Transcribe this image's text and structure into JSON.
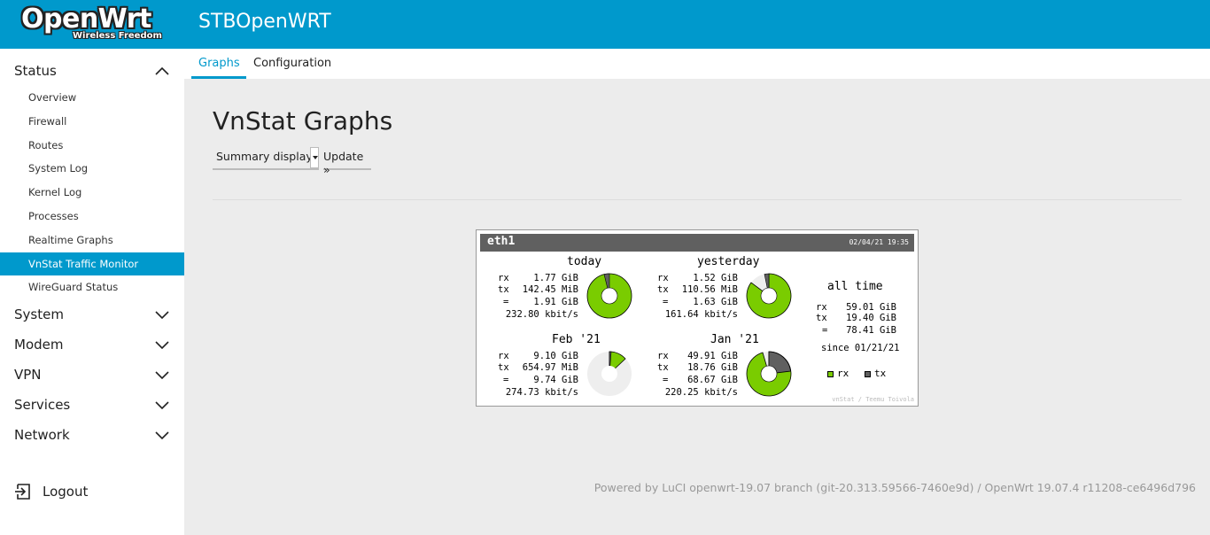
{
  "header": {
    "logo_main": "OpenWrt",
    "logo_sub": "Wireless Freedom",
    "hostname": "STBOpenWRT"
  },
  "sidebar": {
    "status_label": "Status",
    "status_items": [
      {
        "label": "Overview"
      },
      {
        "label": "Firewall"
      },
      {
        "label": "Routes"
      },
      {
        "label": "System Log"
      },
      {
        "label": "Kernel Log"
      },
      {
        "label": "Processes"
      },
      {
        "label": "Realtime Graphs"
      },
      {
        "label": "VnStat Traffic Monitor",
        "active": true
      },
      {
        "label": "WireGuard Status"
      }
    ],
    "groups": [
      "System",
      "Modem",
      "VPN",
      "Services",
      "Network"
    ],
    "logout_label": "Logout"
  },
  "tabs": [
    {
      "label": "Graphs",
      "active": true
    },
    {
      "label": "Configuration",
      "active": false
    }
  ],
  "main": {
    "title": "VnStat Graphs",
    "select_value": "Summary display",
    "update_label": "Update »"
  },
  "vnstat": {
    "interface": "eth1",
    "timestamp": "02/04/21 19:35",
    "today": {
      "title": "today",
      "rx": "1.77 GiB",
      "tx": "142.45 MiB",
      "total": "1.91 GiB",
      "rate": "232.80 kbit/s"
    },
    "yesterday": {
      "title": "yesterday",
      "rx": "1.52 GiB",
      "tx": "110.56 MiB",
      "total": "1.63 GiB",
      "rate": "161.64 kbit/s"
    },
    "feb": {
      "title": "Feb '21",
      "rx": "9.10 GiB",
      "tx": "654.97 MiB",
      "total": "9.74 GiB",
      "rate": "274.73 kbit/s"
    },
    "jan": {
      "title": "Jan '21",
      "rx": "49.91 GiB",
      "tx": "18.76 GiB",
      "total": "68.67 GiB",
      "rate": "220.25 kbit/s"
    },
    "alltime": {
      "title": "all time",
      "rx": "59.01 GiB",
      "tx": "19.40 GiB",
      "total": "78.41 GiB",
      "since": "since 01/21/21"
    },
    "labels": {
      "rx": "rx",
      "tx": "tx",
      "eq": "="
    },
    "legend": {
      "rx": "rx",
      "tx": "tx"
    },
    "credit": "vnStat / Teemu Toivola",
    "colors": {
      "rx": "#7acc00",
      "tx": "#606060",
      "empty": "#eeeeee"
    }
  },
  "footer": "Powered by LuCI openwrt-19.07 branch (git-20.313.59566-7460e9d) / OpenWrt 19.07.4 r11208-ce6496d796"
}
